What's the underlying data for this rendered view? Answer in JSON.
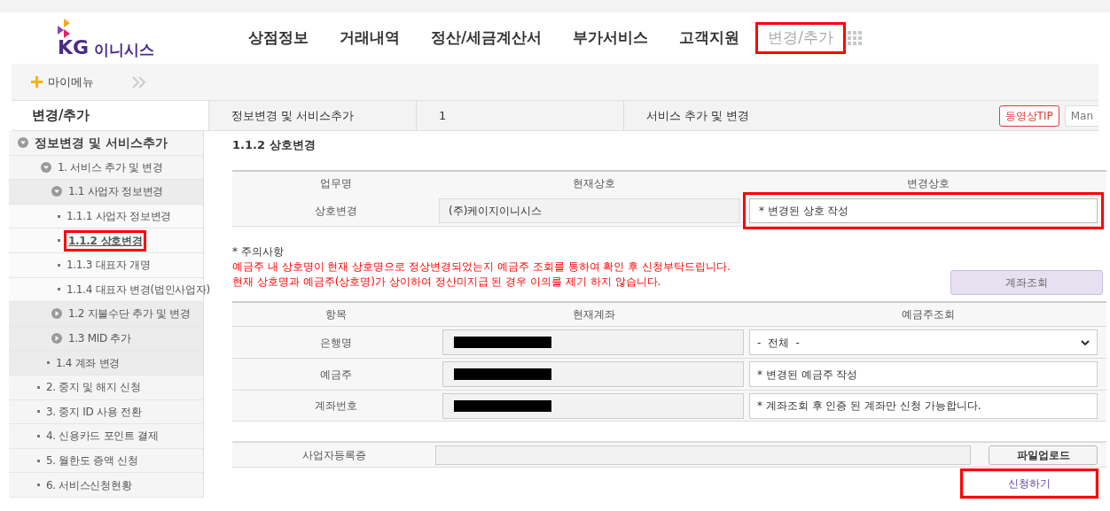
{
  "header": {
    "logo": {
      "mark": "KG",
      "name": "이니시스"
    },
    "nav": [
      {
        "label": "상점정보",
        "selected": false,
        "highlighted": false
      },
      {
        "label": "거래내역",
        "selected": false,
        "highlighted": false
      },
      {
        "label": "정산/세금계산서",
        "selected": false,
        "highlighted": false
      },
      {
        "label": "부가서비스",
        "selected": false,
        "highlighted": false
      },
      {
        "label": "고객지원",
        "selected": false,
        "highlighted": false
      },
      {
        "label": "변경/추가",
        "selected": true,
        "highlighted": true
      }
    ]
  },
  "mymenu": {
    "label": "마이메뉴"
  },
  "breadcrumb": {
    "section": "변경/추가",
    "path": [
      "정보변경 및 서비스추가",
      "1",
      "서비스 추가 및 변경"
    ],
    "buttons": [
      {
        "label": "동영상TIP",
        "kind": "tip"
      },
      {
        "label": "Man",
        "kind": "plain"
      }
    ]
  },
  "sidebar": [
    {
      "label": "정보변경 및 서비스추가",
      "expanded": true,
      "selected": false,
      "highlighted": false,
      "children": [
        {
          "label": "1. 서비스 추가 및 변경",
          "expanded": true,
          "selected": false,
          "highlighted": false,
          "children": [
            {
              "label": "1.1 사업자 정보변경",
              "expanded": true,
              "selected": false,
              "highlighted": false,
              "children": [
                {
                  "label": "1.1.1 사업자 정보변경",
                  "selected": false,
                  "highlighted": false
                },
                {
                  "label": "1.1.2 상호변경",
                  "selected": true,
                  "highlighted": true
                },
                {
                  "label": "1.1.3 대표자 개명",
                  "selected": false,
                  "highlighted": false
                },
                {
                  "label": "1.1.4 대표자 변경(법인사업자)",
                  "selected": false,
                  "highlighted": false
                }
              ]
            },
            {
              "label": "1.2 지불수단 추가 및 변경",
              "expanded": false,
              "selected": false,
              "highlighted": false
            },
            {
              "label": "1.3 MID 추가",
              "expanded": false,
              "selected": false,
              "highlighted": false
            },
            {
              "label": "1.4 계좌 변경",
              "selected": false,
              "highlighted": false
            }
          ]
        }
      ]
    },
    {
      "label": "2. 중지 및 해지 신청",
      "selected": false,
      "highlighted": false
    },
    {
      "label": "3. 중지 ID 사용 전환",
      "selected": false,
      "highlighted": false
    },
    {
      "label": "4. 신용카드 포인트 결제",
      "selected": false,
      "highlighted": false
    },
    {
      "label": "5. 월한도 증액 신청",
      "selected": false,
      "highlighted": false
    },
    {
      "label": "6. 서비스신청현황",
      "selected": false,
      "highlighted": false
    }
  ],
  "page_title": "1.1.2 상호변경",
  "name_table": {
    "columns": [
      "업무명",
      "현재상호",
      "변경상호"
    ],
    "row": {
      "label": "상호변경",
      "current": "(주)케이지이니시스",
      "new_placeholder": "* 변경된 상호 작성",
      "new_highlighted": true
    }
  },
  "notice": {
    "title": "* 주의사항",
    "lines": [
      "예금주 내 상호명이 현재 상호명으로 정상변경되었는지 예금주 조회를 통하여 확인 후 신청부탁드립니다.",
      "현재 상호명과 예금주(상호명)가 상이하여 정산미지급 된 경우 이의를 제기 하지 않습니다."
    ]
  },
  "account_check_button": "계좌조회",
  "account_table": {
    "columns": [
      "항목",
      "현재계좌",
      "예금주조회"
    ],
    "rows": [
      {
        "label": "은행명",
        "kind": "select",
        "value": "-  전체  -"
      },
      {
        "label": "예금주",
        "kind": "input",
        "placeholder": "* 변경된 예금주 작성"
      },
      {
        "label": "계좌번호",
        "kind": "input",
        "placeholder": "* 계좌조회 후 인증 된 계좌만 신청 가능합니다."
      }
    ]
  },
  "file_row": {
    "label": "사업자등록증",
    "button": "파일업로드"
  },
  "submit": {
    "label": "신청하기",
    "highlighted": true
  }
}
